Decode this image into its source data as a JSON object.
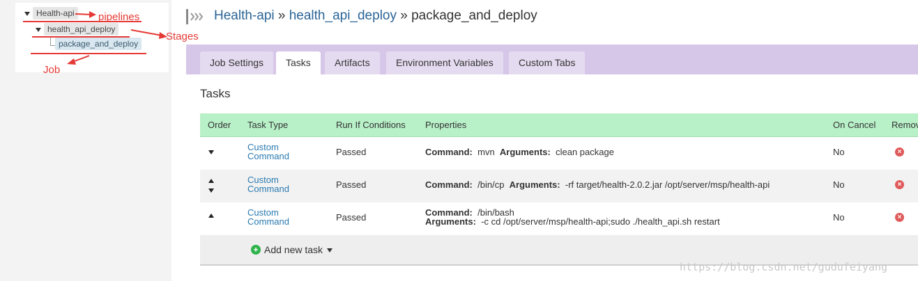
{
  "tree": {
    "pipeline": "Health-api",
    "stage": "health_api_deploy",
    "job": "package_and_deploy"
  },
  "annotations": {
    "pipelines": "pipelines",
    "stages": "Stages",
    "job": "Job",
    "color": "#e53935"
  },
  "breadcrumb": {
    "pipeline": "Health-api",
    "sep1": " » ",
    "stage": "health_api_deploy",
    "sep2": " » ",
    "job": "package_and_deploy"
  },
  "tabs": [
    {
      "label": "Job Settings",
      "active": false
    },
    {
      "label": "Tasks",
      "active": true
    },
    {
      "label": "Artifacts",
      "active": false
    },
    {
      "label": "Environment Variables",
      "active": false
    },
    {
      "label": "Custom Tabs",
      "active": false
    }
  ],
  "section_title": "Tasks",
  "table": {
    "headers": {
      "order": "Order",
      "task_type": "Task Type",
      "run_if": "Run If Conditions",
      "properties": "Properties",
      "on_cancel": "On Cancel",
      "remove": "Remov"
    },
    "rows": [
      {
        "type_line1": "Custom",
        "type_line2": "Command",
        "run_if": "Passed",
        "command_label": "Command:",
        "command": "mvn",
        "arguments_label": "Arguments:",
        "arguments": "clean package",
        "on_cancel": "No"
      },
      {
        "type_line1": "Custom",
        "type_line2": "Command",
        "run_if": "Passed",
        "command_label": "Command:",
        "command": "/bin/cp",
        "arguments_label": "Arguments:",
        "arguments": "-rf target/health-2.0.2.jar /opt/server/msp/health-api",
        "on_cancel": "No"
      },
      {
        "type_line1": "Custom",
        "type_line2": "Command",
        "run_if": "Passed",
        "command_label": "Command:",
        "command": "/bin/bash",
        "arguments_label": "Arguments:",
        "arguments": "-c cd /opt/server/msp/health-api;sudo ./health_api.sh restart",
        "on_cancel": "No"
      }
    ]
  },
  "add_task": "Add new task",
  "watermark": "https://blog.csdn.net/gudufeiyang",
  "colors": {
    "tabs_band": "#d6c7e8",
    "table_header": "#b8f0c8",
    "link": "#2a6496",
    "remove": "#e05a5a",
    "add": "#2db34a"
  }
}
